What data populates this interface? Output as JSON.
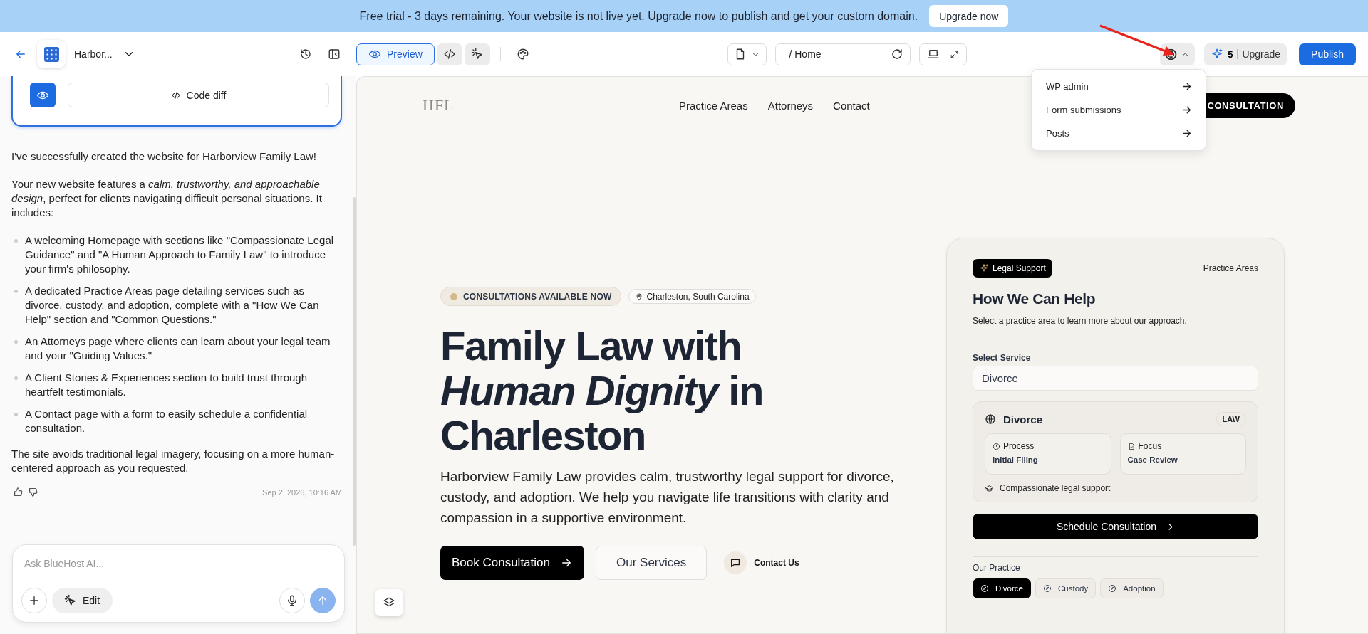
{
  "banner": {
    "text": "Free trial - 3 days remaining. Your website is not live yet. Upgrade now to publish and get your custom domain.",
    "button": "Upgrade now"
  },
  "toolbar": {
    "project": "Harbor...",
    "view_modes": [
      {
        "label": "Preview",
        "selected": true
      },
      {
        "selected": false
      },
      {
        "selected": false
      }
    ],
    "path": "/ Home",
    "wp_menu": {
      "expanded": true,
      "items": [
        "WP admin",
        "Form submissions",
        "Posts"
      ]
    },
    "credits": "5",
    "upgrade": "Upgrade",
    "publish": "Publish"
  },
  "chat": {
    "code_diff": "Code diff",
    "intro": "I've successfully created the website for Harborview Family Law!",
    "description": "Your new website features a *calm, trustworthy, and approachable design*, perfect for clients navigating difficult personal situations. It includes:",
    "features": [
      "A welcoming Homepage with sections like \"Compassionate Legal Guidance\" and \"A Human Approach to Family Law\" to introduce your firm's philosophy.",
      "A dedicated Practice Areas page detailing services such as divorce, custody, and adoption, complete with a \"How We Can Help\" section and \"Common Questions.\"",
      "An Attorneys page where clients can learn about your legal team and your \"Guiding Values.\"",
      "A Client Stories & Experiences section to build trust through heartfelt testimonials.",
      "A Contact page with a form to easily schedule a confidential consultation."
    ],
    "closing": "The site avoids traditional legal imagery, focusing on a more human-centered approach as you requested.",
    "timestamp": "Sep 2, 2026, 10:16 AM",
    "input": {
      "placeholder": "Ask BlueHost AI..."
    },
    "edit": "Edit"
  },
  "site": {
    "logo": "HFL",
    "nav": [
      "Practice Areas",
      "Attorneys",
      "Contact"
    ],
    "cta": "CONSULTATION",
    "hero": {
      "status": "CONSULTATIONS AVAILABLE NOW",
      "location": "Charleston, South Carolina",
      "heading": [
        "Family Law with",
        "*Human Dignity* in",
        "Charleston"
      ],
      "text": "Harborview Family Law provides calm, trustworthy legal support for divorce, custody, and adoption. We help you navigate life transitions with clarity and compassion in a supportive environment.",
      "primary": "Book Consultation",
      "secondary": "Our Services",
      "contact": "Contact Us"
    },
    "card": {
      "tag": "Legal Support",
      "link": "Practice Areas",
      "title": "How We Can Help",
      "description": "Select a practice area to learn more about our approach.",
      "select_label": "Select Service",
      "select_value": "Divorce",
      "service": {
        "name": "Divorce",
        "badge": "LAW",
        "details": [
          {
            "label": "Process",
            "value": "Initial Filing"
          },
          {
            "label": "Focus",
            "value": "Case Review"
          }
        ],
        "note": "Compassionate legal support"
      },
      "button": "Schedule Consultation",
      "practice_label": "Our Practice",
      "practices": [
        {
          "label": "Divorce",
          "selected": true
        },
        {
          "label": "Custody",
          "selected": false
        },
        {
          "label": "Adoption",
          "selected": false
        }
      ]
    }
  }
}
